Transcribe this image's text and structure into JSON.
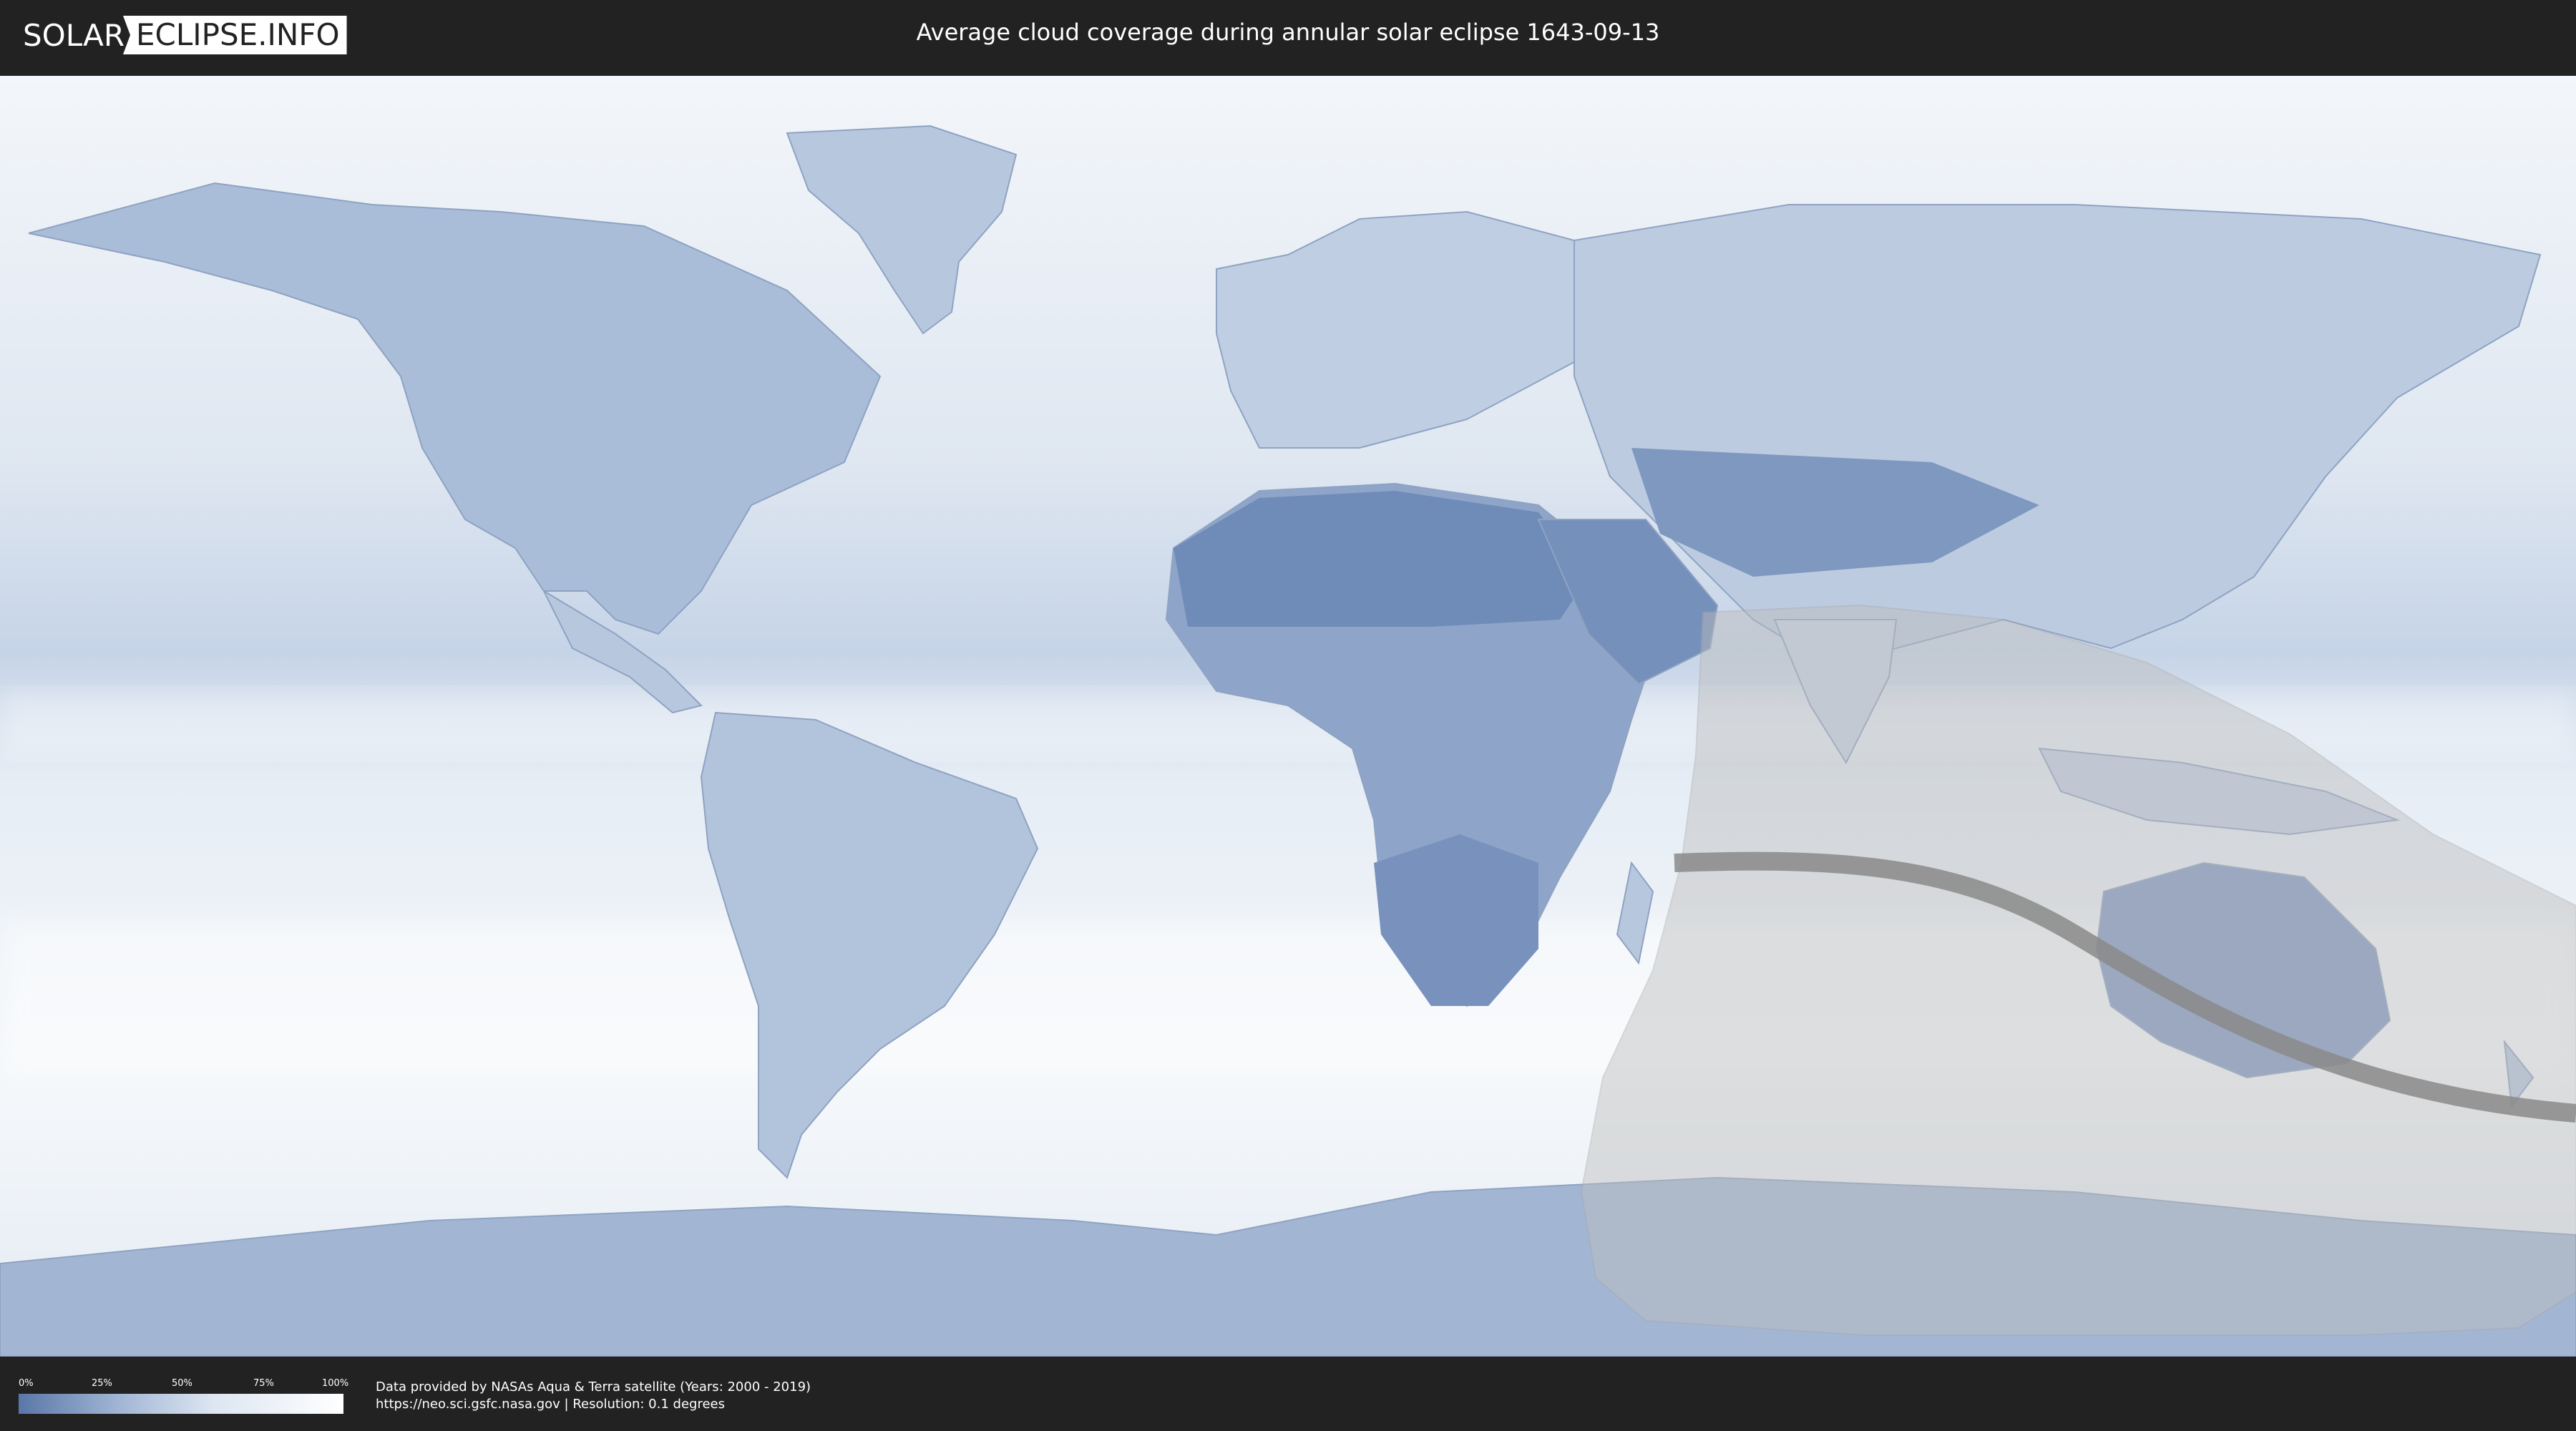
{
  "header": {
    "logo_left": "SOLAR",
    "logo_right": "ECLIPSE.INFO",
    "title": "Average cloud coverage during annular solar eclipse 1643-09-13"
  },
  "legend": {
    "ticks": [
      "0%",
      "25%",
      "50%",
      "75%",
      "100%"
    ],
    "colors": {
      "low": "#5a77a8",
      "high": "#ffffff"
    }
  },
  "footer": {
    "credit_line1": "Data provided by NASAs Aqua & Terra satellite (Years: 2000 - 2019)",
    "credit_line2": "https://neo.sci.gsfc.nasa.gov | Resolution: 0.1 degrees"
  },
  "map": {
    "projection": "equirectangular",
    "colors": {
      "ocean_cloudy": "#e8eef6",
      "clear_land": "#6f8bb8",
      "eclipse_zone": "#c8c8c8",
      "central_path": "#888888"
    }
  }
}
